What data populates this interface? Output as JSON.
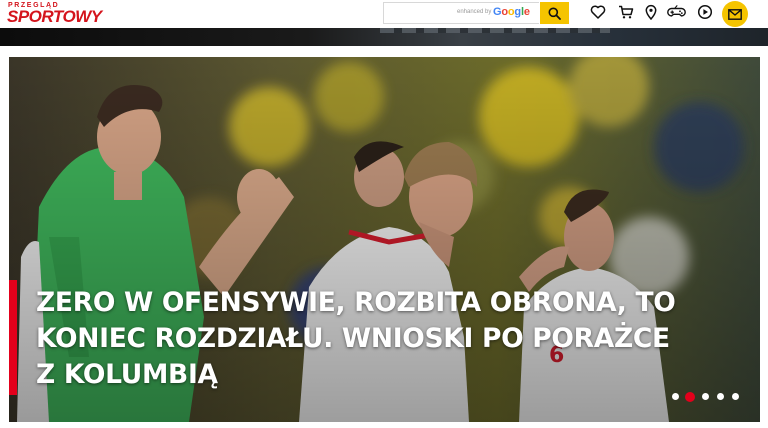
{
  "brand": {
    "logo_top": "PRZEGLĄD",
    "logo_bottom": "SPORTOWY",
    "color": "#d4141c"
  },
  "search": {
    "placeholder": "",
    "powered_by": "enhanced by",
    "google": [
      {
        "ch": "G",
        "color": "#4285f4"
      },
      {
        "ch": "o",
        "color": "#ea4335"
      },
      {
        "ch": "o",
        "color": "#fbbc05"
      },
      {
        "ch": "g",
        "color": "#4285f4"
      },
      {
        "ch": "l",
        "color": "#34a853"
      },
      {
        "ch": "e",
        "color": "#ea4335"
      }
    ],
    "button_color": "#f5c400"
  },
  "nav_icons": [
    "heart-icon",
    "cart-icon",
    "location-pin-icon",
    "gamepad-icon",
    "play-icon",
    "mail-icon"
  ],
  "hero": {
    "headline": "ZERO W OFENSYWIE, ROZBITA OBRONA, TO KONIEC ROZDZIAŁU. WNIOSKI PO PORAŻCE Z KOLUMBIĄ",
    "accent_color": "#e3001b",
    "slides": 5,
    "active_slide": 1
  }
}
